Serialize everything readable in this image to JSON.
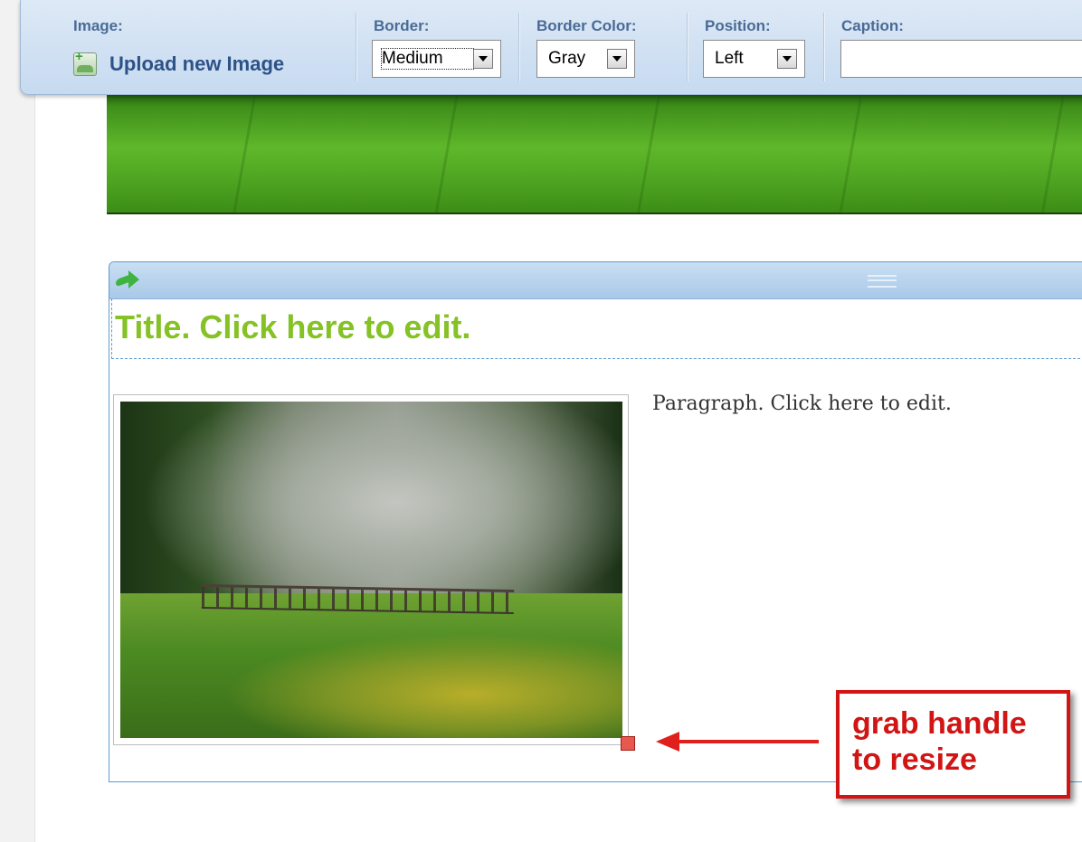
{
  "toolbar": {
    "image_label": "Image:",
    "upload_label": "Upload new Image",
    "border": {
      "label": "Border:",
      "value": "Medium"
    },
    "border_color": {
      "label": "Border Color:",
      "value": "Gray"
    },
    "position": {
      "label": "Position:",
      "value": "Left"
    },
    "caption": {
      "label": "Caption:",
      "value": ""
    }
  },
  "block": {
    "title": "Title. Click here to edit.",
    "paragraph": "Paragraph. Click here to edit."
  },
  "annotation": {
    "line1": "grab handle",
    "line2": "to resize"
  },
  "icons": {
    "upload": "image-add-icon",
    "move": "green-arrow-icon",
    "grip": "drag-grip-icon",
    "dropdown": "chevron-down-icon"
  },
  "colors": {
    "toolbar_bg": "#c6daf0",
    "label_blue": "#4a6b95",
    "upload_text": "#2d5288",
    "title_green": "#84c225",
    "block_border": "#5d9bd1",
    "annotation_red": "#d11414",
    "handle_red": "#e8584f"
  }
}
